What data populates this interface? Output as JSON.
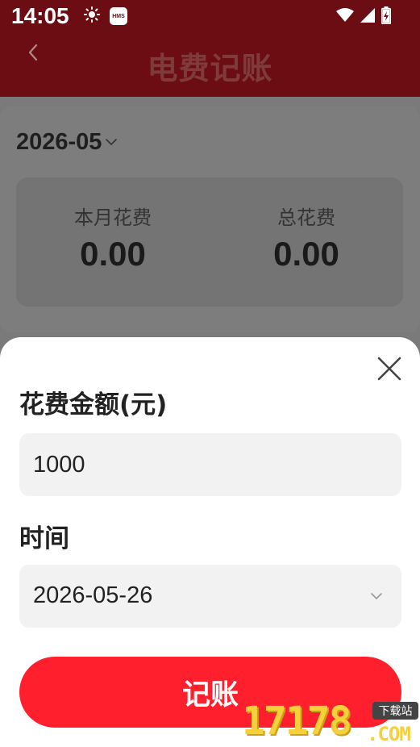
{
  "status_bar": {
    "time": "14:05",
    "badge": "HMS",
    "icons": [
      "sun-icon",
      "hms-icon",
      "wifi-icon",
      "cellular-signal-icon",
      "battery-charging-icon"
    ]
  },
  "header": {
    "title": "电费记账",
    "back_icon": "chevron-left-icon"
  },
  "summary": {
    "month": "2026-05",
    "month_dropdown_icon": "chevron-down-icon",
    "month_spend_label": "本月花费",
    "month_spend_value": "0.00",
    "total_spend_label": "总花费",
    "total_spend_value": "0.00"
  },
  "sheet": {
    "close_icon": "close-icon",
    "amount_label": "花费金额(元)",
    "amount_value": "1000",
    "time_label": "时间",
    "time_value": "2026-05-26",
    "time_dropdown_icon": "chevron-down-icon",
    "submit_label": "记账"
  },
  "watermark": {
    "number": "17178",
    "tag": "下载站",
    "domain": ".COM"
  },
  "colors": {
    "header_bg": "#6b0d12",
    "header_title": "#7f3a3a",
    "accent": "#ff1f2d",
    "field_bg": "#f2f2f2",
    "overlay_bg": "#7a7a7a"
  }
}
